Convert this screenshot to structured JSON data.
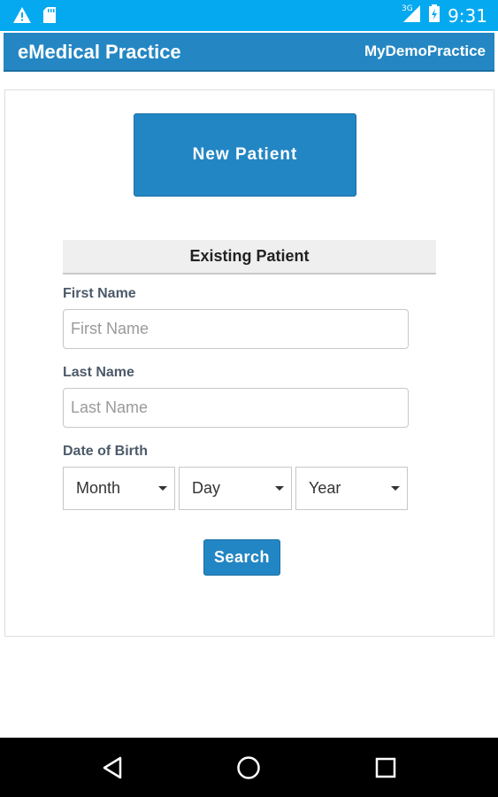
{
  "status_bar": {
    "time": "9:31",
    "network": "3G",
    "icons": [
      "warning-icon",
      "sd-card-icon",
      "signal-icon",
      "battery-icon"
    ]
  },
  "header": {
    "title": "eMedical Practice",
    "practice": "MyDemoPractice"
  },
  "main": {
    "new_patient_label": "New Patient",
    "existing_heading": "Existing Patient",
    "first_name": {
      "label": "First Name",
      "placeholder": "First Name",
      "value": ""
    },
    "last_name": {
      "label": "Last Name",
      "placeholder": "Last Name",
      "value": ""
    },
    "dob": {
      "label": "Date of Birth",
      "month": "Month",
      "day": "Day",
      "year": "Year"
    },
    "search_label": "Search"
  },
  "nav_bar": {
    "icons": [
      "back-icon",
      "home-icon",
      "recents-icon"
    ]
  },
  "colors": {
    "status_bar": "#05a9f0",
    "header": "#2487c4",
    "button": "#2386c4",
    "label": "#4c5a69"
  }
}
